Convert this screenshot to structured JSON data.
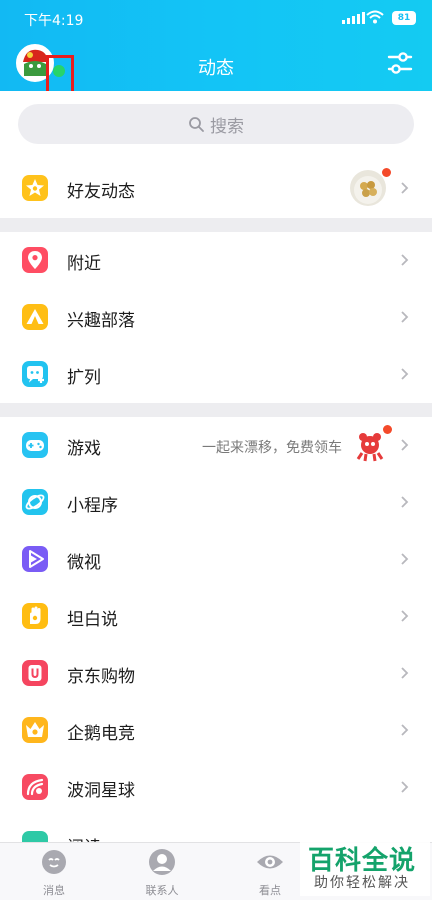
{
  "status_bar": {
    "time": "下午4:19",
    "battery": "81"
  },
  "header": {
    "title": "动态"
  },
  "search": {
    "placeholder": "搜索"
  },
  "sections": {
    "friends": {
      "label": "好友动态"
    },
    "nearby": {
      "label": "附近"
    },
    "tribe": {
      "label": "兴趣部落"
    },
    "kuolie": {
      "label": "扩列"
    },
    "game": {
      "label": "游戏",
      "subtitle": "一起来漂移，免费领车"
    },
    "miniapp": {
      "label": "小程序"
    },
    "weishi": {
      "label": "微视"
    },
    "tanbai": {
      "label": "坦白说"
    },
    "jd": {
      "label": "京东购物"
    },
    "esports": {
      "label": "企鹅电竞"
    },
    "bodong": {
      "label": "波洞星球"
    },
    "partial": {
      "label": "阅读"
    }
  },
  "tabbar": {
    "messages": "消息",
    "contacts": "联系人",
    "kandian": "看点"
  },
  "watermark": {
    "main": "百科全说",
    "sub": "助你轻松解决"
  },
  "colors": {
    "header": "#13c4f6",
    "annotation": "#e81d1d",
    "online": "#27d46a",
    "badge": "#f44a2a"
  },
  "icons": {
    "friends": "star-face-icon",
    "nearby": "location-pin-icon",
    "tribe": "tent-icon",
    "kuolie": "chat-plus-icon",
    "game": "gamepad-icon",
    "miniapp": "orbit-icon",
    "weishi": "play-icon",
    "tanbai": "hand-icon",
    "jd": "jd-bag-icon",
    "esports": "crown-icon",
    "bodong": "planet-icon"
  }
}
